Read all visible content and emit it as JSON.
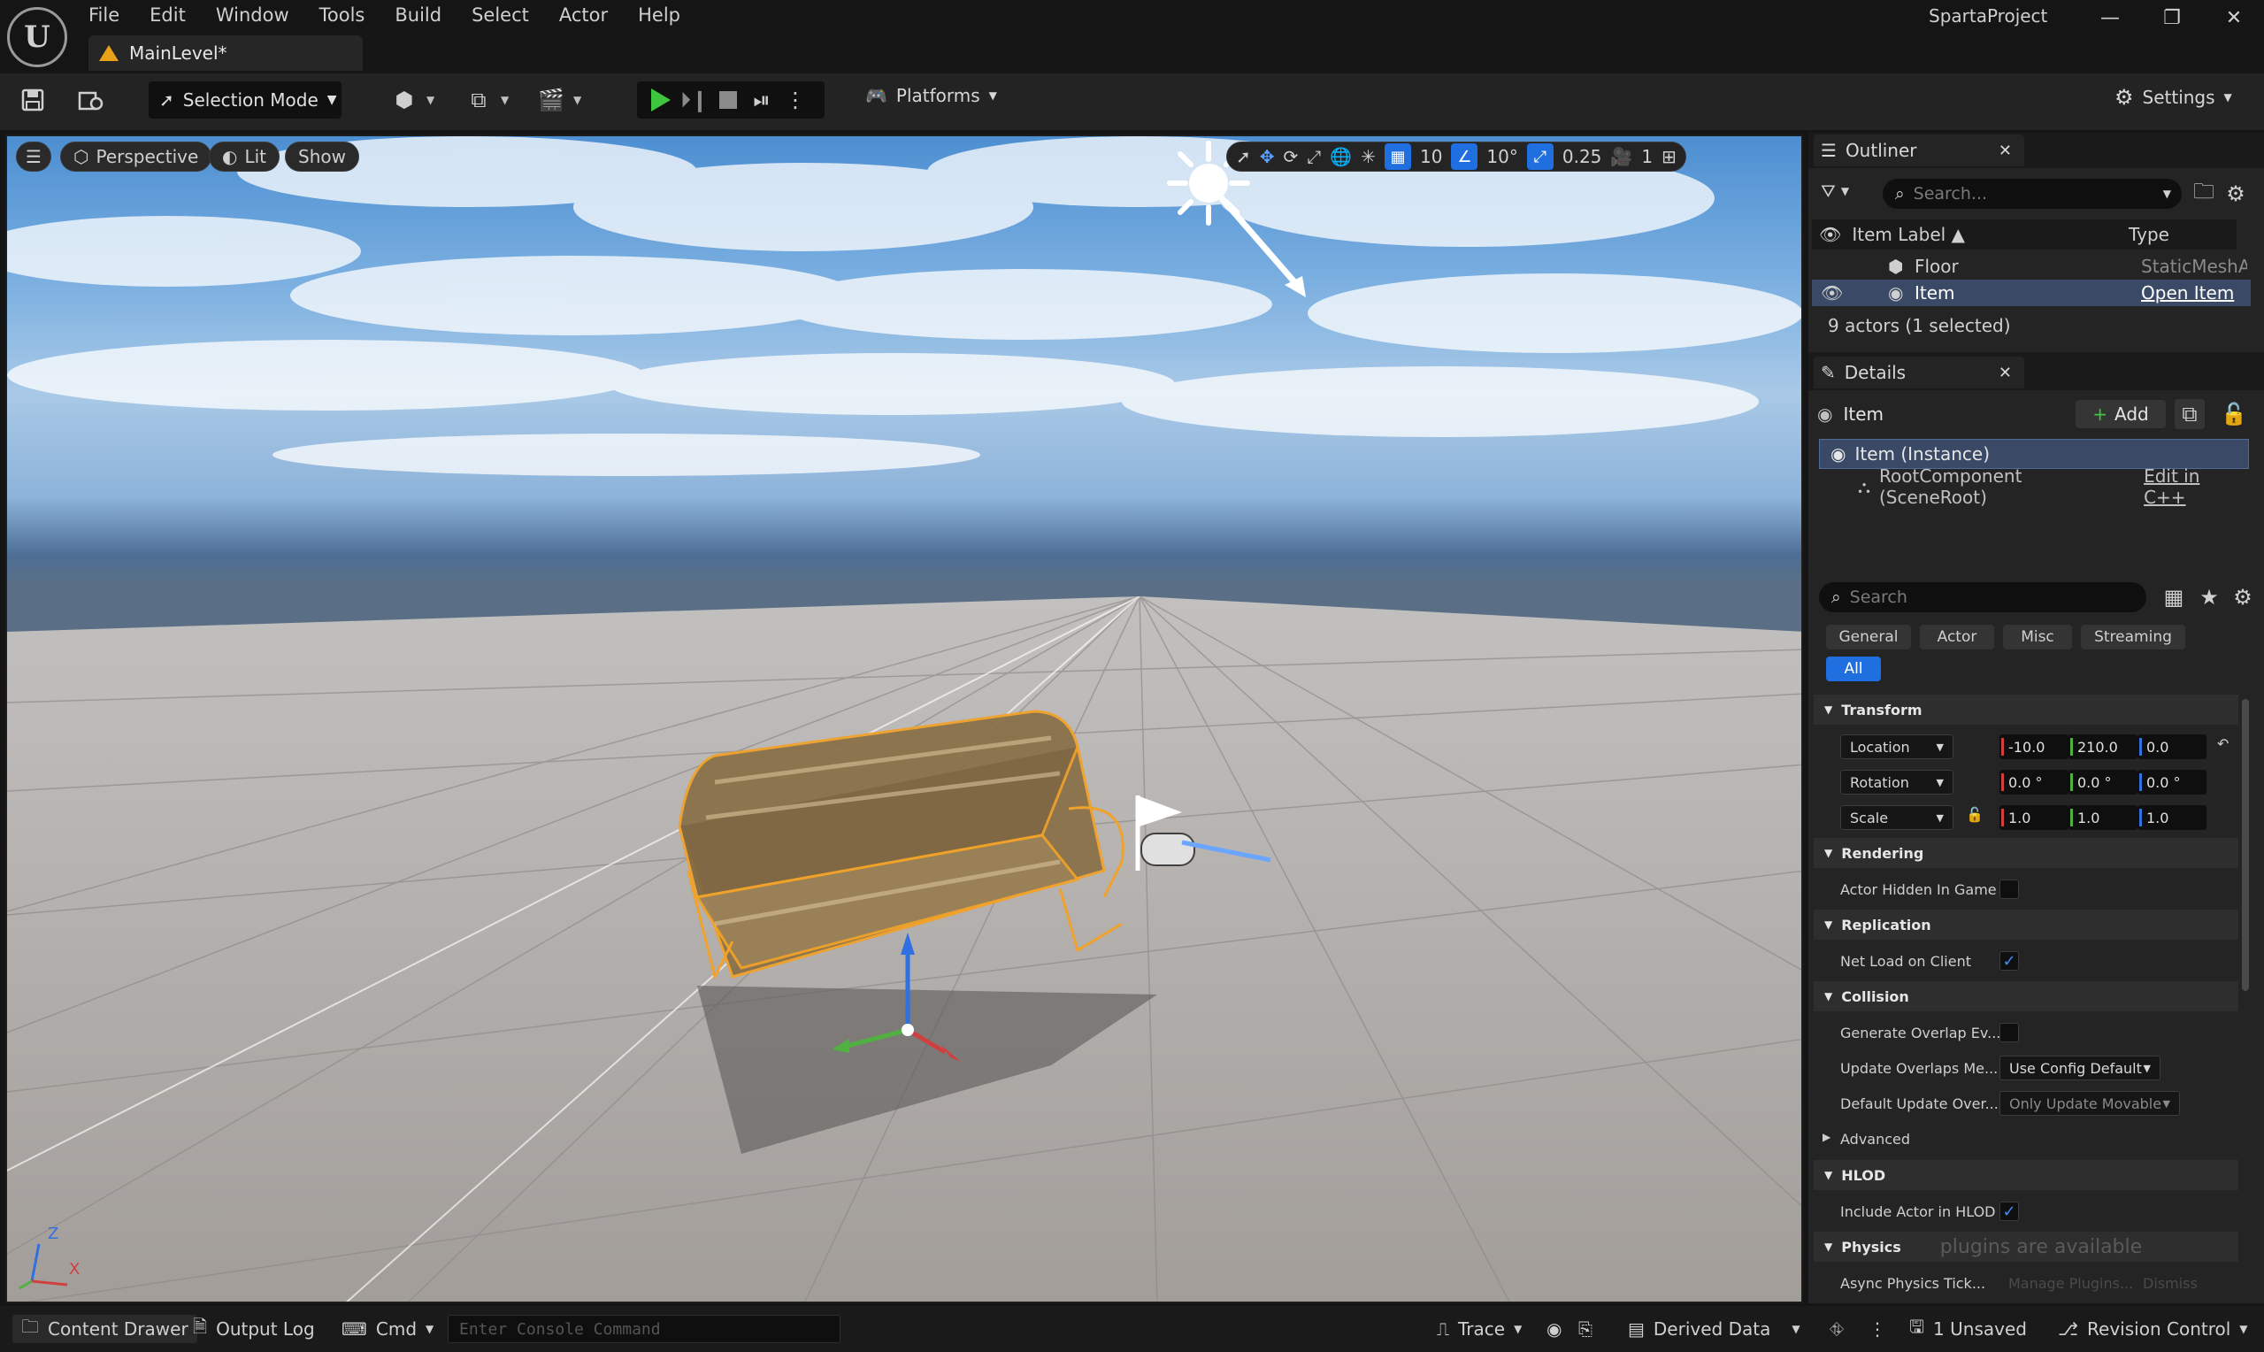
{
  "app": {
    "logo": "U",
    "project_name": "SpartaProject",
    "window_controls": [
      "—",
      "❐",
      "✕"
    ]
  },
  "menu": [
    "File",
    "Edit",
    "Window",
    "Tools",
    "Build",
    "Select",
    "Actor",
    "Help"
  ],
  "document_tab": {
    "label": "MainLevel*"
  },
  "toolbar": {
    "selection_mode": "Selection Mode",
    "platforms": "Platforms",
    "settings": "Settings"
  },
  "viewport": {
    "perspective": "Perspective",
    "lit": "Lit",
    "show": "Show",
    "grid_snap": "10",
    "rotation_snap": "10°",
    "scale_snap": "0.25",
    "camera_speed": "1",
    "axis": {
      "z": "Z",
      "x": "X"
    }
  },
  "outliner": {
    "tab_label": "Outliner",
    "search_placeholder": "Search...",
    "col_item_label": "Item Label ▲",
    "col_type": "Type",
    "rows": [
      {
        "label": "Floor",
        "type": "StaticMeshAc"
      },
      {
        "label": "Item",
        "type": "Open Item"
      }
    ],
    "actor_count": "9 actors (1 selected)"
  },
  "details": {
    "tab_label": "Details",
    "actor_name": "Item",
    "add_label": "Add",
    "instance_label": "Item (Instance)",
    "root_component": "RootComponent (SceneRoot)",
    "edit_cpp": "Edit in C++",
    "search_placeholder": "Search",
    "filters": [
      "General",
      "Actor",
      "Misc",
      "Streaming",
      "All"
    ],
    "sections": {
      "transform": "Transform",
      "rendering": "Rendering",
      "replication": "Replication",
      "collision": "Collision",
      "advanced": "Advanced",
      "hlod": "HLOD",
      "physics": "Physics"
    },
    "location": {
      "label": "Location",
      "x": "-10.0",
      "y": "210.0",
      "z": "0.0"
    },
    "rotation": {
      "label": "Rotation",
      "x": "0.0 °",
      "y": "0.0 °",
      "z": "0.0 °"
    },
    "scale": {
      "label": "Scale",
      "x": "1.0",
      "y": "1.0",
      "z": "1.0"
    },
    "props": {
      "actor_hidden": "Actor Hidden In Game",
      "net_load": "Net Load on Client",
      "generate_overlap": "Generate Overlap Ev...",
      "update_overlaps": "Update Overlaps Me...",
      "update_overlaps_value": "Use Config Default",
      "default_update": "Default Update Over...",
      "default_update_value": "Only Update Movable",
      "include_hlod": "Include Actor in HLOD",
      "async_physics": "Async Physics Tick..."
    },
    "toast": {
      "title": "plugins are available",
      "manage": "Manage Plugins...",
      "dismiss": "Dismiss"
    }
  },
  "statusbar": {
    "content_drawer": "Content Drawer",
    "output_log": "Output Log",
    "cmd": "Cmd",
    "console_placeholder": "Enter Console Command",
    "trace": "Trace",
    "derived_data": "Derived Data",
    "unsaved": "1 Unsaved",
    "revision_control": "Revision Control"
  },
  "colors": {
    "accent_blue": "#1f6fe0",
    "play_green": "#3ec63e",
    "selection_orange": "#e8a21a",
    "x_axis": "#d04040",
    "y_axis": "#50b040",
    "z_axis": "#3070e0"
  }
}
